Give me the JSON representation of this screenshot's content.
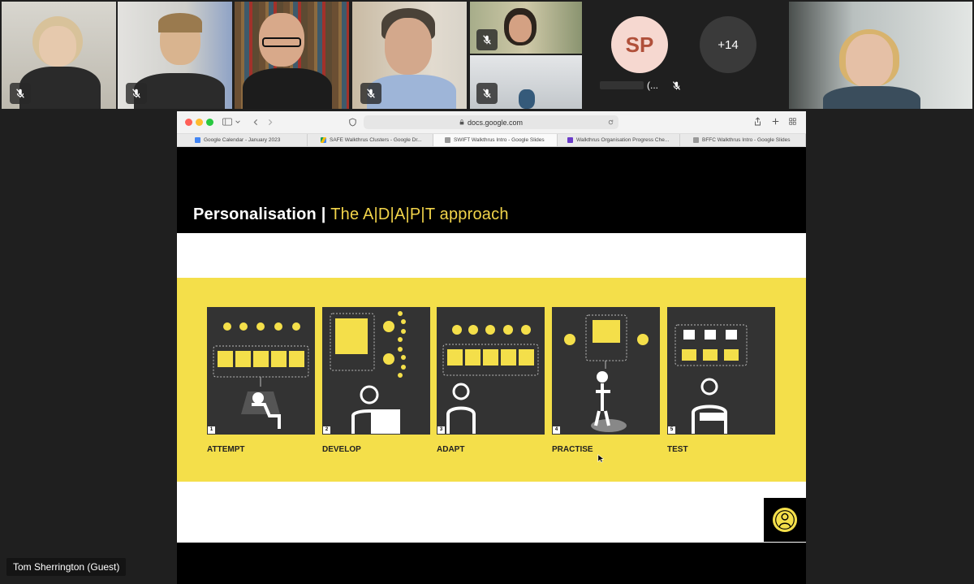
{
  "participants": {
    "sp_initials": "SP",
    "sp_name_suffix": "(...",
    "more_count": "+14"
  },
  "browser": {
    "url": "docs.google.com",
    "tabs": [
      {
        "label": "Google Calendar - January 2023",
        "color": "#4285f4"
      },
      {
        "label": "SAFE Walkthrus Clusters - Google Dr...",
        "color": "#fbbc04"
      },
      {
        "label": "SWIFT Walkthrus Intro - Google Slides",
        "color": "#999999"
      },
      {
        "label": "Walkthrus Organisation Progress Che...",
        "color": "#6a3bc9"
      },
      {
        "label": "BFFC Walkthrus Intro - Google Slides",
        "color": "#999999"
      }
    ]
  },
  "slide": {
    "title_main": "Personalisation |",
    "title_sub": "The A|D|A|P|T approach",
    "steps": [
      {
        "num": "1",
        "label": "ATTEMPT"
      },
      {
        "num": "2",
        "label": "DEVELOP"
      },
      {
        "num": "3",
        "label": "ADAPT"
      },
      {
        "num": "4",
        "label": "PRACTISE"
      },
      {
        "num": "5",
        "label": "TEST"
      }
    ]
  },
  "footer": {
    "speaker_name": "Tom Sherrington (Guest)"
  },
  "colors": {
    "accent_yellow": "#f4df4a",
    "active_outline": "#7b7ff0",
    "avatar_bg": "#f6d8d0",
    "avatar_text": "#b0503a"
  }
}
